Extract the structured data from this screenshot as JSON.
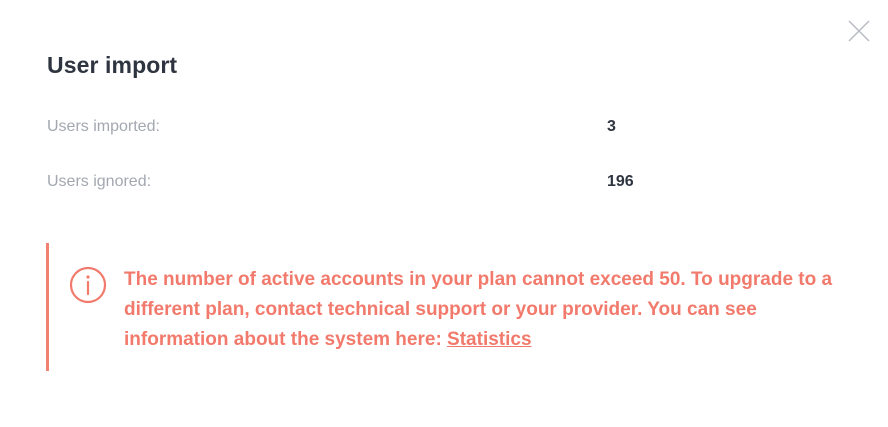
{
  "dialog": {
    "title": "User import",
    "close_icon": "close-icon"
  },
  "stats": {
    "imported_label": "Users imported:",
    "imported_value": "3",
    "ignored_label": "Users ignored:",
    "ignored_value": "196"
  },
  "alert": {
    "icon": "info-icon",
    "message": "The number of active accounts in your plan cannot exceed 50. To upgrade to a different plan, contact technical support or your provider. You can see information about the system here: ",
    "link_label": "Statistics",
    "color": "#f27a6c"
  }
}
